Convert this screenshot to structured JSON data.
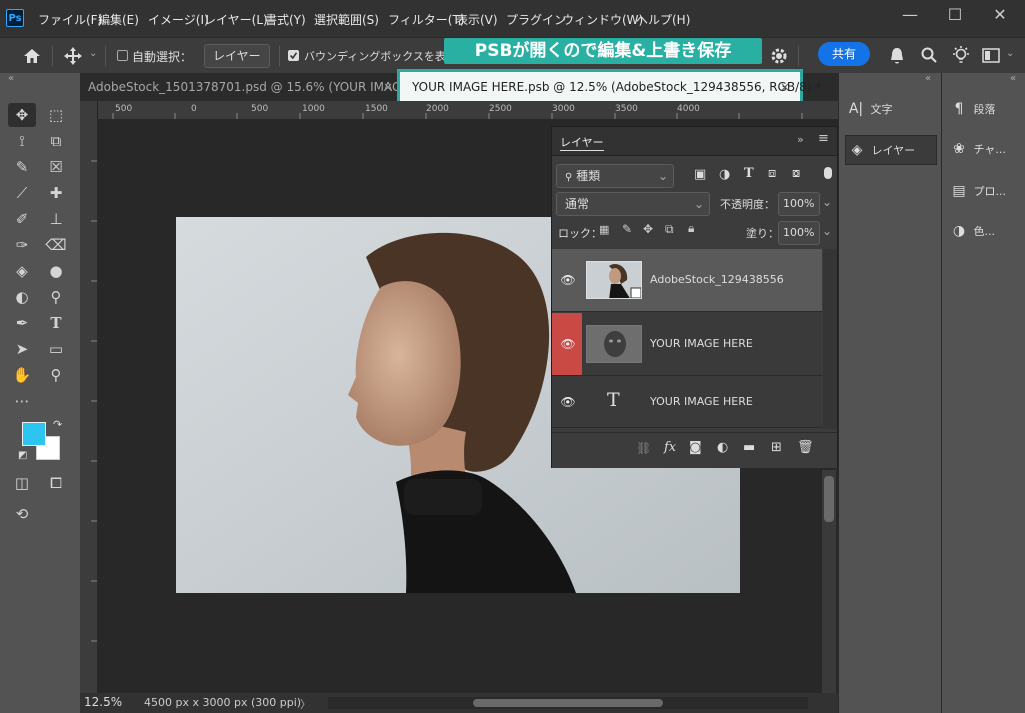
{
  "app": {
    "logo": "Ps"
  },
  "menu": [
    "ファイル(F)",
    "編集(E)",
    "イメージ(I)",
    "レイヤー(L)",
    "書式(Y)",
    "選択範囲(S)",
    "フィルター(T)",
    "表示(V)",
    "プラグイン",
    "ウィンドウ(W)",
    "ヘルプ(H)"
  ],
  "window_controls": {
    "minimize": "—",
    "maximize": "☐",
    "close": "✕"
  },
  "options": {
    "auto_select_label": "自動選択：",
    "auto_select_target": "レイヤー",
    "bounding_box_label": "バウンディングボックスを表示",
    "share_label": "共有"
  },
  "callout": "PSBが開くので編集&上書き保存",
  "tabs": {
    "inactive": "AdobeStock_1501378701.psd @ 15.6% (YOUR IMAG...",
    "inactive_close": "×",
    "active": "YOUR IMAGE HERE.psb @ 12.5% (AdobeStock_129438556, RGB/8) *",
    "active_close": "×"
  },
  "ruler_ticks": [
    "500",
    "0",
    "500",
    "1000",
    "1500",
    "2000",
    "2500",
    "3000",
    "3500",
    "4000"
  ],
  "status": {
    "zoom": "12.5%",
    "doc_size": "4500 px x 3000 px (300 ppi)",
    "arrow": "〉"
  },
  "layers_panel": {
    "title": "レイヤー",
    "filter_label": "種類",
    "blend_mode": "通常",
    "opacity_label": "不透明度：",
    "opacity_value": "100%",
    "lock_label": "ロック：",
    "fill_label": "塗り：",
    "fill_value": "100%",
    "layers": [
      {
        "name": "AdobeStock_129438556",
        "type": "smart-object",
        "selected": true
      },
      {
        "name": "YOUR IMAGE HERE",
        "type": "smart-object",
        "visibility_highlight": "#c94a45"
      },
      {
        "name": "YOUR IMAGE HERE",
        "type": "text",
        "thumb_glyph": "T"
      }
    ],
    "footer_fx": "fx"
  },
  "right_panels": {
    "col1": [
      {
        "icon": "character-icon",
        "label": "文字"
      },
      {
        "icon": "layers-icon",
        "label": "レイヤー"
      }
    ],
    "col2": [
      {
        "icon": "paragraph-icon",
        "label": "段落"
      },
      {
        "icon": "channels-icon",
        "label": "チャ..."
      },
      {
        "icon": "properties-icon",
        "label": "プロ..."
      },
      {
        "icon": "color-icon",
        "label": "色..."
      }
    ]
  },
  "colors": {
    "foreground": "#2ec4f0",
    "background": "#ffffff",
    "accent": "#1473e6",
    "callout": "#29b0a3"
  }
}
